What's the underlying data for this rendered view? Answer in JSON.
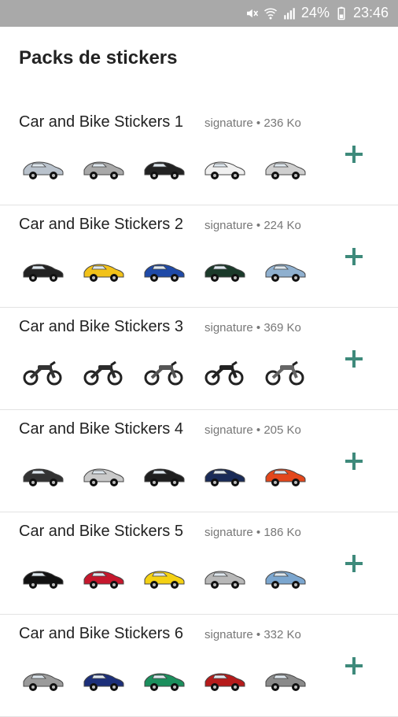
{
  "status_bar": {
    "battery": "24%",
    "time": "23:46",
    "icons": [
      "mute-icon",
      "wifi-icon",
      "signal-icon",
      "battery-icon"
    ]
  },
  "page": {
    "title": "Packs de stickers"
  },
  "packs": [
    {
      "name": "Car and Bike Stickers 1",
      "author": "signature",
      "size": "236 Ko",
      "thumbs": [
        {
          "kind": "car",
          "color": "#b9c2cc"
        },
        {
          "kind": "car",
          "color": "#a9a9a9"
        },
        {
          "kind": "car",
          "color": "#222"
        },
        {
          "kind": "car",
          "color": "#f0f0f0"
        },
        {
          "kind": "car",
          "color": "#cfcfcf"
        }
      ]
    },
    {
      "name": "Car and Bike Stickers 2",
      "author": "signature",
      "size": "224 Ko",
      "thumbs": [
        {
          "kind": "car",
          "color": "#222"
        },
        {
          "kind": "car",
          "color": "#f2c219"
        },
        {
          "kind": "car",
          "color": "#1f4aa8"
        },
        {
          "kind": "car",
          "color": "#1b3a2a"
        },
        {
          "kind": "car",
          "color": "#8fb0cf"
        }
      ]
    },
    {
      "name": "Car and Bike Stickers 3",
      "author": "signature",
      "size": "369 Ko",
      "thumbs": [
        {
          "kind": "bike",
          "color": "#333"
        },
        {
          "kind": "bike",
          "color": "#2b2b2b"
        },
        {
          "kind": "bike",
          "color": "#555"
        },
        {
          "kind": "bike",
          "color": "#222"
        },
        {
          "kind": "bike",
          "color": "#666"
        }
      ]
    },
    {
      "name": "Car and Bike Stickers 4",
      "author": "signature",
      "size": "205 Ko",
      "thumbs": [
        {
          "kind": "car",
          "color": "#333"
        },
        {
          "kind": "car",
          "color": "#c9c9c9"
        },
        {
          "kind": "car",
          "color": "#1f1f1f"
        },
        {
          "kind": "car",
          "color": "#1a2b58"
        },
        {
          "kind": "car",
          "color": "#e3471c"
        }
      ]
    },
    {
      "name": "Car and Bike Stickers 5",
      "author": "signature",
      "size": "186 Ko",
      "thumbs": [
        {
          "kind": "car",
          "color": "#111"
        },
        {
          "kind": "car",
          "color": "#c6172d"
        },
        {
          "kind": "car",
          "color": "#f4d113"
        },
        {
          "kind": "car",
          "color": "#b8b8b8"
        },
        {
          "kind": "car",
          "color": "#7ba6cf"
        }
      ]
    },
    {
      "name": "Car and Bike Stickers 6",
      "author": "signature",
      "size": "332 Ko",
      "thumbs": [
        {
          "kind": "car",
          "color": "#9b9b9b"
        },
        {
          "kind": "car",
          "color": "#1c2f7a"
        },
        {
          "kind": "car",
          "color": "#1b8f5d"
        },
        {
          "kind": "car",
          "color": "#b61b1b"
        },
        {
          "kind": "car",
          "color": "#8a8a8a"
        }
      ]
    }
  ],
  "colors": {
    "accent": "#3e8a7b",
    "separator": "#e3e3e3",
    "statusbar": "#a9a9a9"
  }
}
